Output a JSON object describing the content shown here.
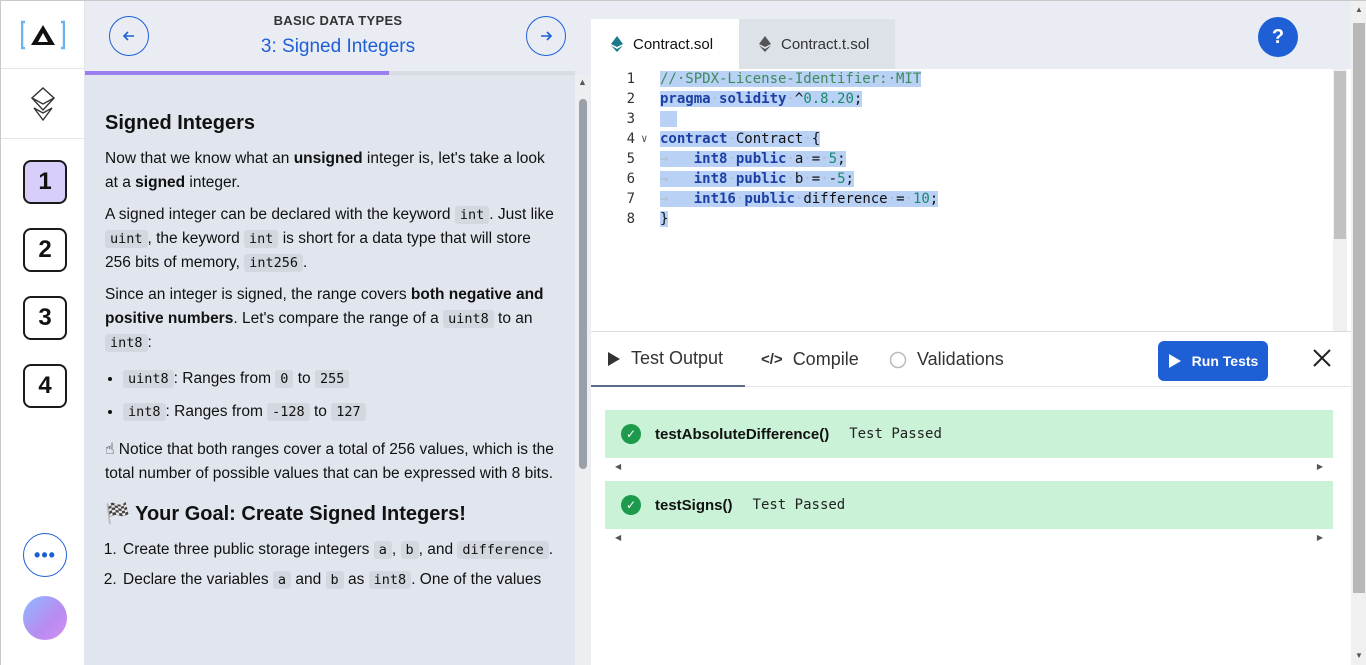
{
  "rail": {
    "stages": [
      "1",
      "2",
      "3",
      "4"
    ],
    "active_stage": "1",
    "more_label": "•••"
  },
  "lesson": {
    "kicker": "BASIC DATA TYPES",
    "title": "3: Signed Integers",
    "progress": 0.62,
    "heading": "Signed Integers",
    "p1_a": "Now that we know what an ",
    "p1_b": "unsigned",
    "p1_c": " integer is, let's take a look at a ",
    "p1_d": "signed",
    "p1_e": " integer.",
    "p2_a": "A signed integer can be declared with the keyword ",
    "p2_code1": "int",
    "p2_b": ". Just like ",
    "p2_code2": "uint",
    "p2_c": ", the keyword ",
    "p2_code3": "int",
    "p2_d": " is short for a data type that will store 256 bits of memory, ",
    "p2_code4": "int256",
    "p2_e": ".",
    "p3_a": "Since an integer is signed, the range covers ",
    "p3_b": "both negative and positive numbers",
    "p3_c": ". Let's compare the range of a ",
    "p3_code1": "uint8",
    "p3_d": " to an ",
    "p3_code2": "int8",
    "p3_e": ":",
    "li1_code": "uint8",
    "li1_text": ": Ranges from ",
    "li1_from": "0",
    "li1_to_word": " to ",
    "li1_to": "255",
    "li2_code": "int8",
    "li2_text": ": Ranges from ",
    "li2_from": "-128",
    "li2_to_word": " to ",
    "li2_to": "127",
    "note_icon": "☝",
    "note": " Notice that both ranges cover a total of 256 values, which is the total number of possible values that can be expressed with 8 bits.",
    "goal_icon": "🏁",
    "goal": " Your Goal: Create Signed Integers!",
    "step1_a": "Create three public storage integers ",
    "step1_code1": "a",
    "step1_b": ", ",
    "step1_code2": "b",
    "step1_c": ", and ",
    "step1_code3": "difference",
    "step1_d": ".",
    "step2_a": "Declare the variables ",
    "step2_code1": "a",
    "step2_b": " and ",
    "step2_code2": "b",
    "step2_c": " as ",
    "step2_code3": "int8",
    "step2_d": ". One of the values"
  },
  "editor": {
    "tabs": [
      {
        "label": "Contract.sol",
        "icon": "ethereum-icon"
      },
      {
        "label": "Contract.t.sol",
        "icon": "ethereum-icon"
      }
    ],
    "help_label": "?",
    "lines": [
      "1",
      "2",
      "3",
      "4",
      "5",
      "6",
      "7",
      "8"
    ]
  },
  "tests": {
    "tabs": [
      "Test Output",
      "Compile",
      "Validations"
    ],
    "run_label": "Run Tests",
    "results": [
      {
        "name": "testAbsoluteDifference()",
        "status": "Test Passed"
      },
      {
        "name": "testSigns()",
        "status": "Test Passed"
      }
    ]
  },
  "colors": {
    "accent": "#1e5fd6",
    "active_stage": "#d9cdfa",
    "pass_bg": "#c9f2d6",
    "pass_icon": "#1d9a4b",
    "selection": "#b8d1f5"
  }
}
